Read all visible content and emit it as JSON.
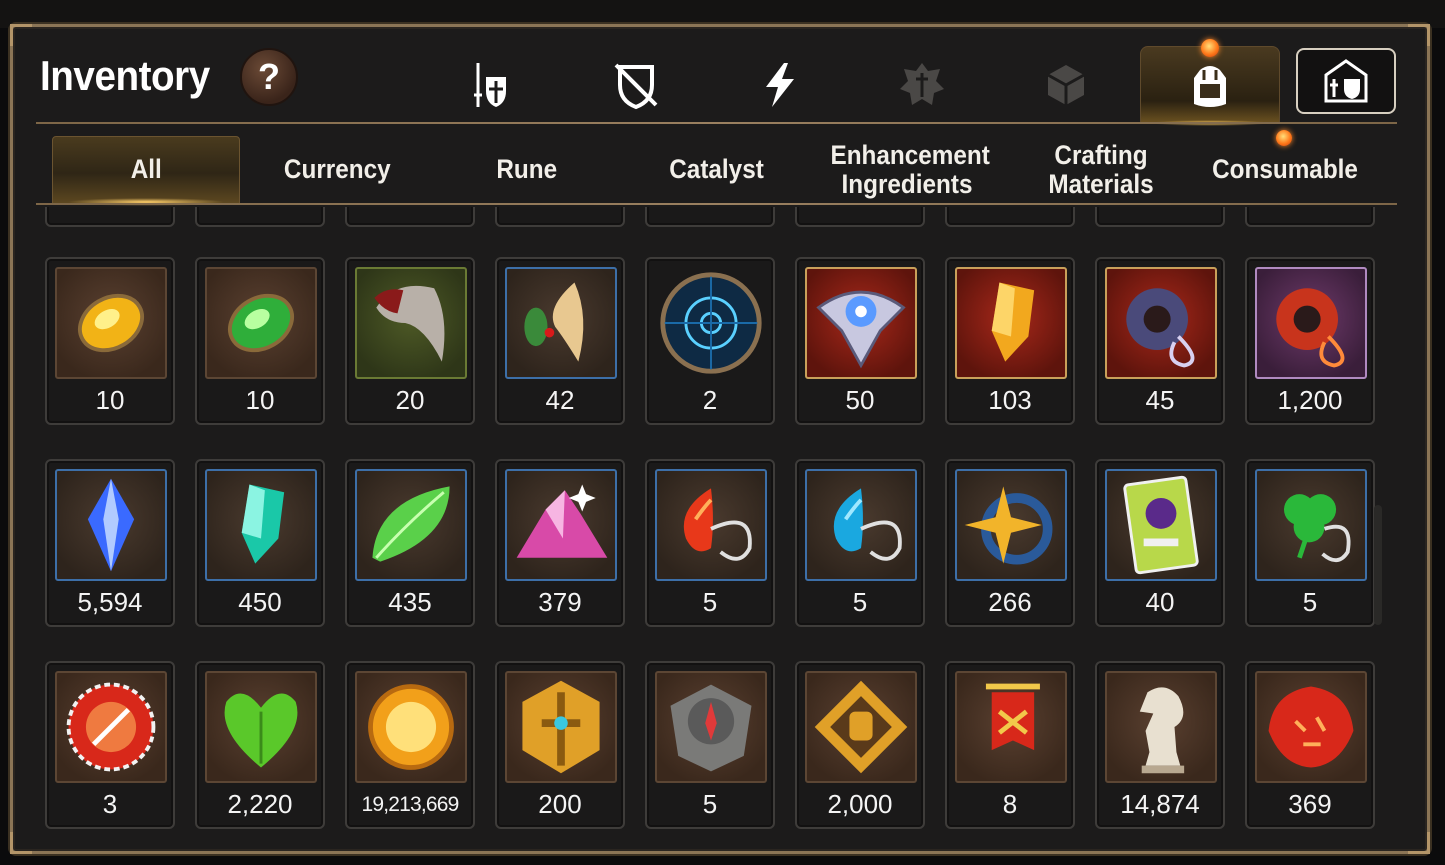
{
  "window": {
    "title": "Inventory"
  },
  "help": {
    "label": "?"
  },
  "top_tabs": [
    {
      "icon": "hero-sword-shield-icon",
      "active": false
    },
    {
      "icon": "broken-shield-icon",
      "active": false
    },
    {
      "icon": "lightning-icon",
      "active": false
    },
    {
      "icon": "guild-emblem-icon",
      "active": false
    },
    {
      "icon": "dice-cube-icon",
      "active": false
    },
    {
      "icon": "backpack-icon",
      "active": true,
      "notification": true
    },
    {
      "icon": "castle-icon",
      "active": false
    }
  ],
  "sub_tabs": [
    {
      "label": "All",
      "active": true
    },
    {
      "label": "Currency",
      "active": false
    },
    {
      "label": "Rune",
      "active": false
    },
    {
      "label": "Catalyst",
      "active": false
    },
    {
      "label": "Enhancement Ingredients",
      "active": false
    },
    {
      "label": "Crafting Materials",
      "active": false
    },
    {
      "label": "Consumable",
      "active": false,
      "notification": true
    }
  ],
  "rows": [
    [
      {
        "icon": "amber-rune-stone-icon",
        "count": "10",
        "frame": "brown"
      },
      {
        "icon": "green-rune-stone-icon",
        "count": "10",
        "frame": "brown"
      },
      {
        "icon": "beast-claw-icon",
        "count": "20",
        "frame": "green"
      },
      {
        "icon": "herb-root-icon",
        "count": "42",
        "frame": "blue"
      },
      {
        "icon": "blue-portal-orb-icon",
        "count": "2",
        "frame": "orb"
      },
      {
        "icon": "crystal-eye-icon",
        "count": "50",
        "frame": "red"
      },
      {
        "icon": "golden-crystal-icon",
        "count": "103",
        "frame": "red"
      },
      {
        "icon": "dark-ring-pendant-icon",
        "count": "45",
        "frame": "red"
      },
      {
        "icon": "fire-ring-icon",
        "count": "1,200",
        "frame": "purple"
      }
    ],
    [
      {
        "icon": "blue-gem-icon",
        "count": "5,594",
        "frame": "blue"
      },
      {
        "icon": "teal-crystal-icon",
        "count": "450",
        "frame": "blue"
      },
      {
        "icon": "green-leaf-icon",
        "count": "435",
        "frame": "blue"
      },
      {
        "icon": "pink-ore-pile-icon",
        "count": "379",
        "frame": "blue"
      },
      {
        "icon": "fire-pendant-icon",
        "count": "5",
        "frame": "blue"
      },
      {
        "icon": "water-pendant-icon",
        "count": "5",
        "frame": "blue"
      },
      {
        "icon": "star-pendant-icon",
        "count": "266",
        "frame": "blue"
      },
      {
        "icon": "costume-card-icon",
        "count": "40",
        "frame": "blue"
      },
      {
        "icon": "clover-pendant-icon",
        "count": "5",
        "frame": "blue"
      }
    ],
    [
      {
        "icon": "red-seal-badge-icon",
        "count": "3",
        "frame": "brown"
      },
      {
        "icon": "green-heart-icon",
        "count": "2,220",
        "frame": "brown"
      },
      {
        "icon": "sun-coin-icon",
        "count": "19,213,669",
        "frame": "brown",
        "small": true
      },
      {
        "icon": "golden-sword-badge-icon",
        "count": "200",
        "frame": "brown"
      },
      {
        "icon": "stone-compass-icon",
        "count": "5",
        "frame": "brown"
      },
      {
        "icon": "fist-emblem-icon",
        "count": "2,000",
        "frame": "brown"
      },
      {
        "icon": "war-banner-icon",
        "count": "8",
        "frame": "brown"
      },
      {
        "icon": "chess-knight-icon",
        "count": "14,874",
        "frame": "brown"
      },
      {
        "icon": "red-leaf-sigil-icon",
        "count": "369",
        "frame": "brown"
      }
    ]
  ],
  "colors": {
    "frame_brown": "#4a3424",
    "frame_blue": "#2a3a52",
    "frame_green": "#3a4a22",
    "frame_red": "#8a1f14",
    "frame_purple": "#5a2a5a",
    "accent_gold": "#c9a46a"
  }
}
